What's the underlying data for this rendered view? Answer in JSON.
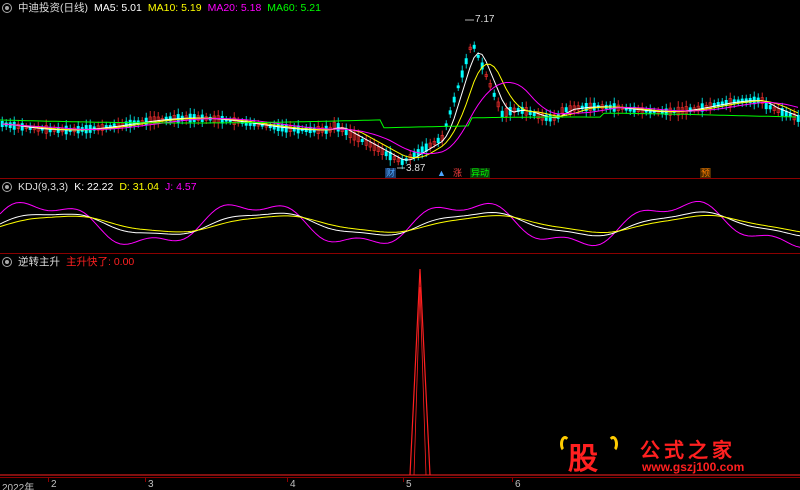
{
  "main_panel": {
    "title": "中迪投资(日线)",
    "ma": [
      {
        "label": "MA5: 5.01",
        "color": "#ffffff"
      },
      {
        "label": "MA10: 5.19",
        "color": "#ffff00"
      },
      {
        "label": "MA20: 5.18",
        "color": "#ff00ff"
      },
      {
        "label": "MA60: 5.21",
        "color": "#00ff00"
      }
    ],
    "high_label": "7.17",
    "low_label": "3.87",
    "badges": [
      {
        "text": "财",
        "color": "#4da6ff"
      },
      {
        "text": "▲",
        "color": "#4da6ff"
      },
      {
        "text": "涨",
        "color": "#ff4040"
      },
      {
        "text": "异动",
        "color": "#00ff00"
      },
      {
        "text": "预",
        "color": "#ff8000"
      }
    ]
  },
  "kdj_panel": {
    "name": "KDJ(9,3,3)",
    "k": "K: 22.22",
    "d": "D: 31.04",
    "j": "J: 4.57",
    "k_color": "#ffffff",
    "d_color": "#ffff00",
    "j_color": "#ff00ff"
  },
  "signal_panel": {
    "name": "逆转主升",
    "value": "主升快了: 0.00",
    "value_color": "#ff2020"
  },
  "time_axis": {
    "labels": [
      "2022年",
      "2",
      "3",
      "4",
      "5",
      "6"
    ]
  },
  "watermark": {
    "char": "股",
    "name": "公式之家",
    "url": "www.gszj100.com"
  }
}
